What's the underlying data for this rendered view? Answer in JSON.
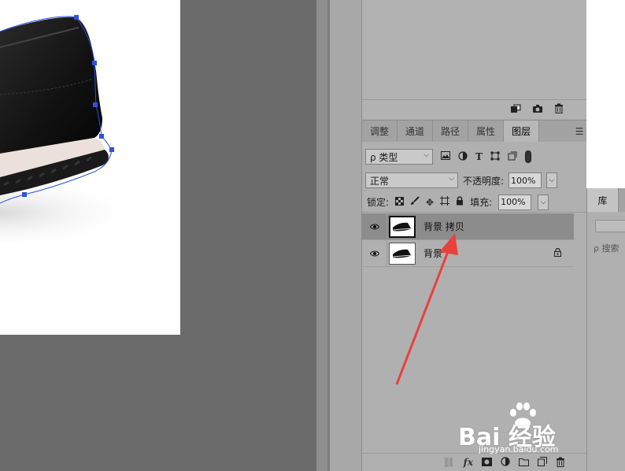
{
  "layers_panel": {
    "tabs": [
      {
        "label": "调整"
      },
      {
        "label": "通道"
      },
      {
        "label": "路径"
      },
      {
        "label": "属性"
      },
      {
        "label": "图层",
        "active": true
      }
    ],
    "menu_icon": "hamburger-icon",
    "filter": {
      "label": "ρ 类型",
      "icons": [
        "image-filter-icon",
        "adjustment-filter-icon",
        "type-filter-icon",
        "shape-filter-icon",
        "smart-object-filter-icon"
      ]
    },
    "blend_mode": "正常",
    "opacity_label": "不透明度:",
    "opacity_value": "100%",
    "lock_label": "锁定:",
    "fill_label": "填充:",
    "fill_value": "100%",
    "layers": [
      {
        "name": "背景 拷贝",
        "visible": true,
        "selected": true,
        "locked": false
      },
      {
        "name": "背景",
        "visible": true,
        "selected": false,
        "locked": true
      }
    ],
    "bottom_icons": [
      "link-icon",
      "fx-icon",
      "mask-icon",
      "adjustment-layer-icon",
      "folder-icon",
      "new-layer-icon",
      "trash-icon"
    ],
    "fx_label": "fx"
  },
  "upper_panel": {
    "icons": [
      "new-snapshot-icon",
      "camera-icon",
      "trash-icon"
    ]
  },
  "library_panel": {
    "tab_label": "库",
    "search_placeholder": "ρ 搜索"
  },
  "watermark": {
    "logo": "Bai  经验",
    "url": "jingyan.baidu.com"
  },
  "colors": {
    "arrow": "#e8413c",
    "selected_layer": "#8c8c8c",
    "panel_bg": "#b0b0b0",
    "path": "#3050e0"
  }
}
